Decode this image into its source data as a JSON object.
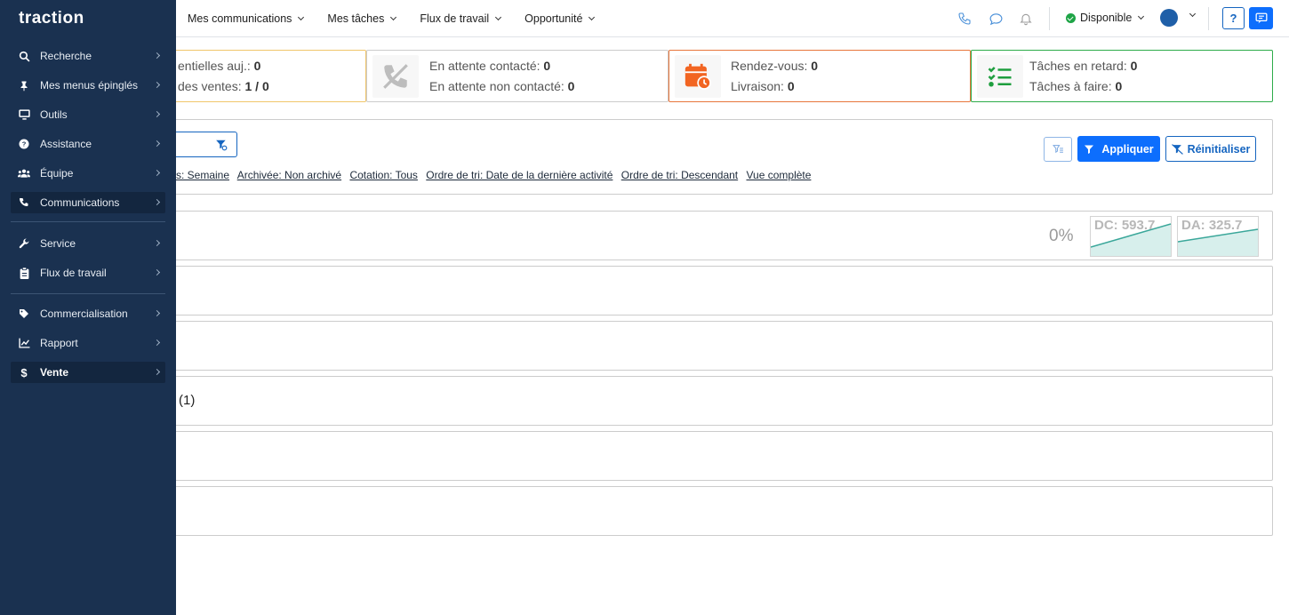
{
  "sidebar": {
    "logo": "traction",
    "items": [
      {
        "label": "Recherche",
        "icon": "search-icon"
      },
      {
        "label": "Mes menus épinglés",
        "icon": "pin-icon"
      },
      {
        "label": "Outils",
        "icon": "monitor-icon"
      },
      {
        "label": "Assistance",
        "icon": "question-circle-icon"
      },
      {
        "label": "Équipe",
        "icon": "users-icon"
      },
      {
        "label": "Communications",
        "icon": "phone-icon"
      },
      {
        "label": "Service",
        "icon": "wrench-icon"
      },
      {
        "label": "Flux de travail",
        "icon": "clipboard-icon"
      },
      {
        "label": "Commercialisation",
        "icon": "tag-icon"
      },
      {
        "label": "Rapport",
        "icon": "line-chart-icon"
      },
      {
        "label": "Vente",
        "icon": "dollar-icon"
      }
    ]
  },
  "topnav": {
    "items": [
      "Mes communications",
      "Mes tâches",
      "Flux de travail",
      "Opportunité"
    ]
  },
  "status": {
    "label": "Disponible",
    "color": "#1ea446"
  },
  "help_label": "?",
  "cards": {
    "c1": {
      "line1_label": "entielles auj.:",
      "line1_value": "0",
      "line2_label": "des ventes:",
      "line2_value": "1 / 0",
      "border": "#f0c66b"
    },
    "c2": {
      "line1_label": "En attente contacté:",
      "line1_value": "0",
      "line2_label": "En attente non contacté:",
      "line2_value": "0",
      "border": "#cccccc",
      "icon": "phone-slash-icon"
    },
    "c3": {
      "line1_label": "Rendez-vous:",
      "line1_value": "0",
      "line2_label": "Livraison:",
      "line2_value": "0",
      "border": "#e8763b",
      "icon": "calendar-clock-icon"
    },
    "c4": {
      "line1_label": "Tâches en retard:",
      "line1_value": "0",
      "line2_label": "Tâches à faire:",
      "line2_value": "0",
      "border": "#2eac4a",
      "icon": "task-list-icon"
    }
  },
  "filters": {
    "chips": [
      "s: Semaine",
      "Archivée: Non archivé",
      "Cotation: Tous",
      "Ordre de tri: Date de la dernière activité",
      "Ordre de tri: Descendant",
      "Vue complète"
    ],
    "apply_label": "Appliquer",
    "reset_label": "Réinitialiser"
  },
  "summary": {
    "percent": "0%",
    "spark_dc": "DC: 593.7",
    "spark_da": "DA: 325.7"
  },
  "rows": {
    "count_label": "(1)"
  },
  "colors": {
    "sidebar": "#1a3150",
    "primary": "#0d6efd",
    "accent_orange": "#ff6a2b",
    "success": "#1ea446"
  }
}
